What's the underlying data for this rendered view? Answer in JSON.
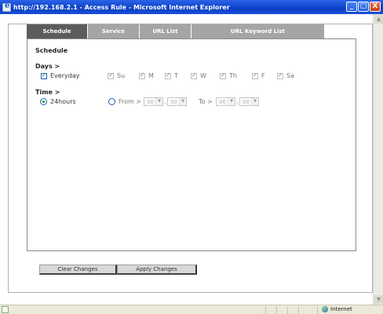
{
  "window": {
    "title": "http://192.168.2.1 - Access Rule - Microsoft Internet Explorer",
    "buttons": {
      "minimize": "_",
      "maximize": "□",
      "close": "X"
    }
  },
  "tabs": [
    {
      "label": "Schedule",
      "active": true
    },
    {
      "label": "Service",
      "active": false
    },
    {
      "label": "URL List",
      "active": false
    },
    {
      "label": "URL Keyword List",
      "active": false
    }
  ],
  "schedule": {
    "section_title": "Schedule",
    "days_label": "Days >",
    "days": [
      {
        "label": "Everyday",
        "checked": true,
        "enabled": true
      },
      {
        "label": "Su",
        "checked": true,
        "enabled": false
      },
      {
        "label": "M",
        "checked": true,
        "enabled": false
      },
      {
        "label": "T",
        "checked": true,
        "enabled": false
      },
      {
        "label": "W",
        "checked": true,
        "enabled": false
      },
      {
        "label": "Th",
        "checked": true,
        "enabled": false
      },
      {
        "label": "F",
        "checked": true,
        "enabled": false
      },
      {
        "label": "Sa",
        "checked": true,
        "enabled": false
      }
    ],
    "time_label": "Time >",
    "time_options": [
      {
        "label": "24hours",
        "selected": true
      },
      {
        "label": "From >",
        "selected": false
      }
    ],
    "from": {
      "hour": "00",
      "minute": "00"
    },
    "to_label": "To >",
    "to": {
      "hour": "00",
      "minute": "00"
    }
  },
  "actions": {
    "clear_label": "Clear Changes",
    "apply_label": "Apply Changes"
  },
  "statusbar": {
    "zone": "Internet"
  },
  "colors": {
    "active_tab": "#5c5c5c",
    "inactive_tab": "#a5a5a5",
    "titlebar": "#0a3fc4"
  }
}
